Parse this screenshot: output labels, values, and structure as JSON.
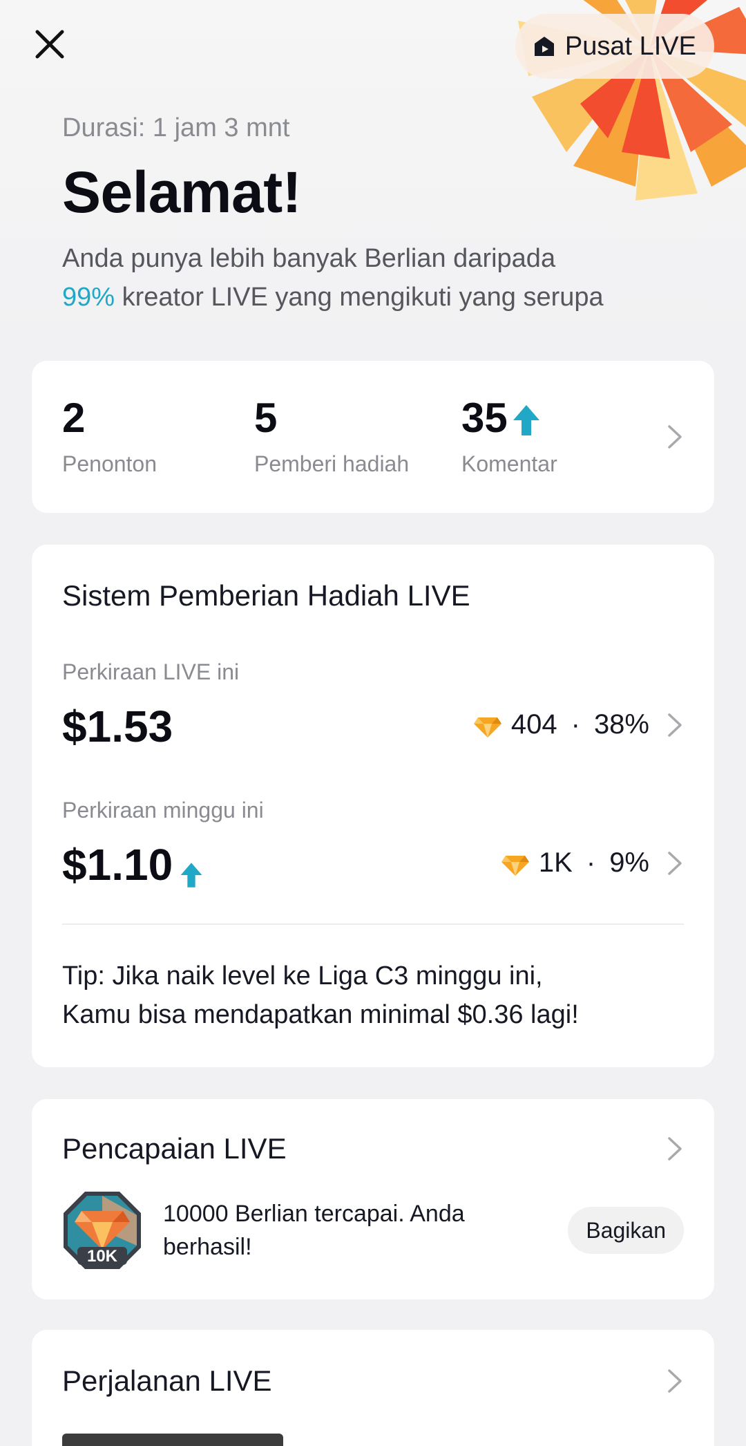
{
  "header": {
    "close_icon": "close-icon",
    "live_center_label": "Pusat LIVE",
    "live_center_icon": "home-icon"
  },
  "summary": {
    "duration": "Durasi: 1 jam 3 mnt",
    "headline": "Selamat!",
    "subtitle_before": "Anda punya lebih banyak Berlian daripada",
    "subtitle_pct": "99%",
    "subtitle_after": " kreator LIVE yang mengikuti yang serupa",
    "pct_color": "#20a8c6"
  },
  "stats": {
    "viewers": {
      "value": "2",
      "label": "Penonton"
    },
    "gifters": {
      "value": "5",
      "label": "Pemberi hadiah"
    },
    "comments": {
      "value": "35",
      "label": "Komentar",
      "trend": "up"
    }
  },
  "rewards": {
    "title": "Sistem Pemberian Hadiah LIVE",
    "this_live": {
      "label": "Perkiraan LIVE ini",
      "amount": "$1.53",
      "diamonds": "404",
      "percent": "38%"
    },
    "this_week": {
      "label": "Perkiraan minggu ini",
      "amount": "$1.10",
      "trend": "up",
      "diamonds": "1K",
      "percent": "9%"
    },
    "separator": "·",
    "tip_line1": "Tip: Jika naik level ke Liga C3 minggu ini,",
    "tip_line2": "Kamu bisa mendapatkan minimal $0.36 lagi!"
  },
  "achievements": {
    "title": "Pencapaian LIVE",
    "badge_label": "10K",
    "text": "10000 Berlian tercapai. Anda berhasil!",
    "share_label": "Bagikan"
  },
  "journey": {
    "title": "Perjalanan LIVE"
  },
  "colors": {
    "accent_teal": "#20a8c6",
    "diamond": "#f5a623",
    "burst_orange": "#f7a43a",
    "burst_red": "#f24d2e"
  }
}
